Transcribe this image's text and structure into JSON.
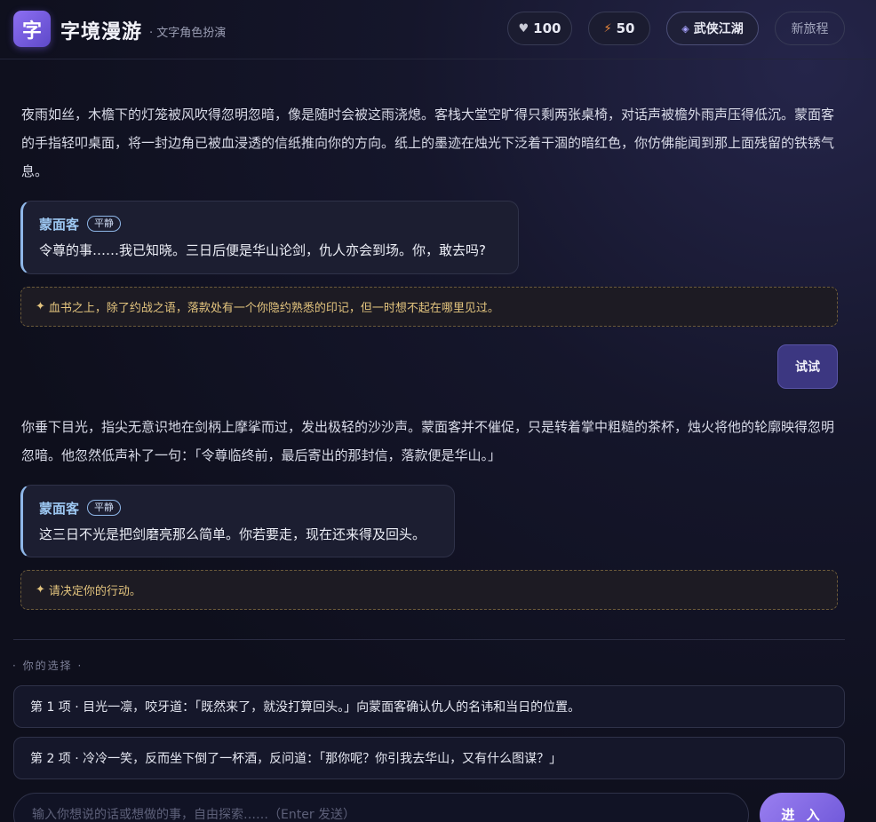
{
  "header": {
    "logo_char": "字",
    "brand": "字境漫游",
    "tagline": "· 文字角色扮演",
    "hp": "100",
    "energy": "50",
    "genre": "武侠江湖",
    "new_journey": "新旅程",
    "icons": {
      "hp": "heart-icon",
      "energy": "lightning-icon",
      "genre": "gem-icon"
    }
  },
  "story": {
    "narration_1": "夜雨如丝，木檐下的灯笼被风吹得忽明忽暗，像是随时会被这雨浇熄。客栈大堂空旷得只剩两张桌椅，对话声被檐外雨声压得低沉。蒙面客的手指轻叩桌面，将一封边角已被血浸透的信纸推向你的方向。纸上的墨迹在烛光下泛着干涸的暗红色，你仿佛能闻到那上面残留的铁锈气息。",
    "dialogue_1": {
      "speaker": "蒙面客",
      "mood": "平静",
      "line": "令尊的事……我已知晓。三日后便是华山论剑，仇人亦会到场。你，敢去吗?"
    },
    "hint_1": "血书之上，除了约战之语，落款处有一个你隐约熟悉的印记，但一时想不起在哪里见过。",
    "user_message": "试试",
    "narration_2": "你垂下目光，指尖无意识地在剑柄上摩挲而过，发出极轻的沙沙声。蒙面客并不催促，只是转着掌中粗糙的茶杯，烛火将他的轮廓映得忽明忽暗。他忽然低声补了一句：「令尊临终前，最后寄出的那封信，落款便是华山。」",
    "dialogue_2": {
      "speaker": "蒙面客",
      "mood": "平静",
      "line": "这三日不光是把剑磨亮那么简单。你若要走，现在还来得及回头。"
    },
    "hint_2": "请决定你的行动。",
    "hint_icon": "✦"
  },
  "choices": {
    "title": "· 你的选择 ·",
    "items": [
      {
        "label": "第 1 项 · 目光一凛，咬牙道：「既然来了，就没打算回头。」向蒙面客确认仇人的名讳和当日的位置。"
      },
      {
        "label": "第 2 项 · 冷冷一笑，反而坐下倒了一杯酒，反问道：「那你呢？你引我去华山，又有什么图谋？」"
      }
    ]
  },
  "composer": {
    "value": "",
    "placeholder": "输入你想说的话或想做的事，自由探索……（Enter 发送）",
    "send_label": "进 入"
  },
  "colors": {
    "accent": "#7b62e0",
    "speaker": "#9cc6f0",
    "hint": "#e3c47e",
    "user_bubble": "#3c3781"
  }
}
